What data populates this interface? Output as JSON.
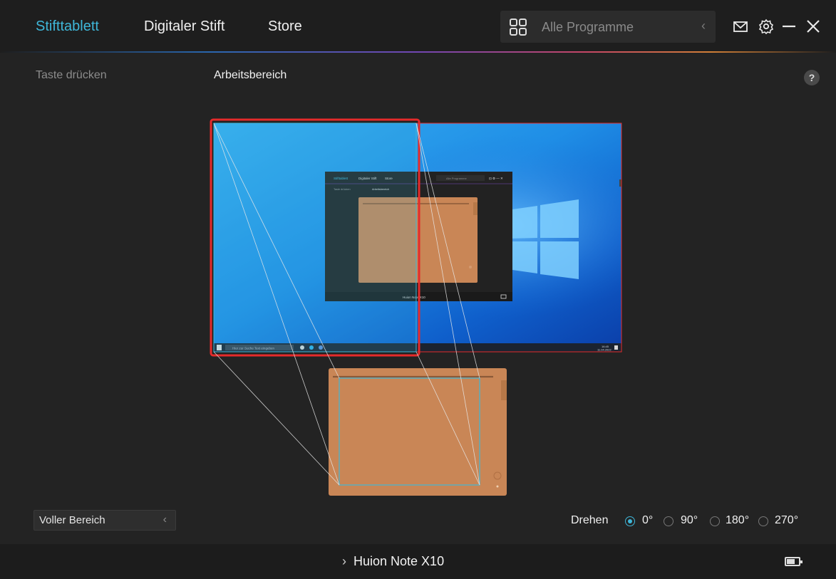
{
  "nav": {
    "tabs": [
      {
        "label": "Stifttablett",
        "active": true
      },
      {
        "label": "Digitaler Stift",
        "active": false
      },
      {
        "label": "Store",
        "active": false
      }
    ],
    "programs_label": "Alle Programme",
    "accent_color": "#3fb7d9"
  },
  "subtabs": [
    {
      "label": "Taste drücken",
      "active": false
    },
    {
      "label": "Arbeitsbereich",
      "active": true
    }
  ],
  "help_label": "?",
  "preview": {
    "mini_tabs": [
      "Stifttablett",
      "Digitaler Stift",
      "Store"
    ],
    "mini_programs": "Alle Programme",
    "mini_subtabs": [
      "Taste drücken",
      "Arbeitsbereich"
    ],
    "mini_device": "Huion Note X10",
    "taskbar_search": "Hier zur Suche Text eingeben",
    "tray_time": "16:45",
    "tray_date": "11.04.2022"
  },
  "controls": {
    "range_value": "Voller Bereich",
    "rotate_label": "Drehen",
    "rotations": [
      {
        "label": "0°",
        "selected": true
      },
      {
        "label": "90°",
        "selected": false
      },
      {
        "label": "180°",
        "selected": false
      },
      {
        "label": "270°",
        "selected": false
      }
    ]
  },
  "footer": {
    "device_name": "Huion Note X10"
  },
  "colors": {
    "selection_red": "#e52b2b",
    "tablet_orange": "#c98656",
    "desktop_blue": "#1a7bd6"
  }
}
